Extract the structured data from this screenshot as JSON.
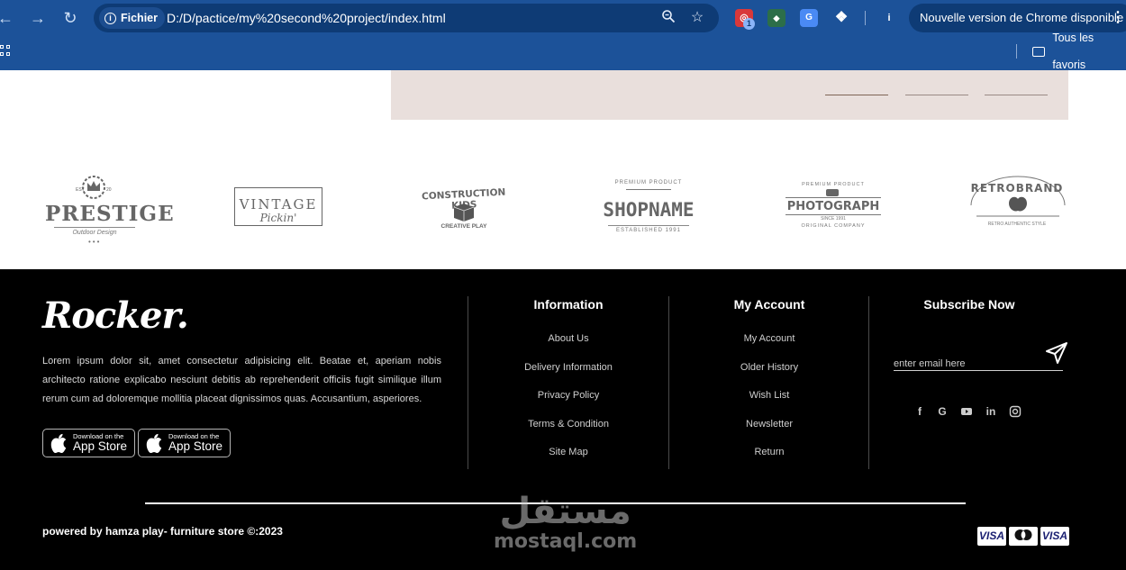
{
  "browser": {
    "back_icon": "arrow-left-icon",
    "forward_icon": "arrow-right-icon",
    "reload_icon": "reload-icon",
    "chip_label": "Fichier",
    "url": "D:/D/pactice/my%20second%20project/index.html",
    "zoom_icon": "zoom-icon",
    "star_icon": "star-icon",
    "ext_badge": "1",
    "update_text": "Nouvelle version de Chrome disponible",
    "menu_icon": "more-vert-icon",
    "bookmarks_label": "Tous les favoris"
  },
  "brands": [
    "PRESTIGE",
    "VINTAGE",
    "CONSTRUCTION KIDS",
    "SHOPNAME",
    "PHOTOGRAPH",
    "RETROBRAND"
  ],
  "brand_subtexts": {
    "prestige": "Outdoor Design",
    "vintage": "Pickin'",
    "construction": "CREATIVE PLAY",
    "shopname_top": "PREMIUM PRODUCT",
    "shopname_bottom": "ESTABLISHED 1991",
    "photograph_top": "PREMIUM PRODUCT",
    "photograph_mid": "SINCE 1991",
    "photograph_bottom": "ORIGINAL COMPANY",
    "retro_bottom": "RETRO AUTHENTIC STYLE"
  },
  "footer": {
    "logo": "Rocker.",
    "about": "Lorem ipsum dolor sit, amet consectetur adipisicing elit. Beatae et, aperiam nobis architecto ratione explicabo nesciunt debitis ab reprehenderit officiis fugit similique illum rerum cum ad doloremque mollitia placeat dignissimos quas. Accusantium, asperiores.",
    "store_small": "Download on the",
    "store_big": "App Store",
    "information": {
      "title": "Information",
      "links": [
        "About Us",
        "Delivery Information",
        "Privacy Policy",
        "Terms & Condition",
        "Site Map"
      ]
    },
    "account": {
      "title": "My Account",
      "links": [
        "My Account",
        "Older History",
        "Wish List",
        "Newsletter",
        "Return"
      ]
    },
    "subscribe": {
      "title": "Subscribe Now",
      "placeholder": "enter email here"
    },
    "social_icons": [
      "facebook-icon",
      "google-icon",
      "youtube-icon",
      "linkedin-icon",
      "instagram-icon"
    ],
    "copyright": "powered by hamza play- furniture store ©:2023",
    "payment": [
      "VISA",
      "MASTERCARD",
      "VISA"
    ]
  },
  "watermark": {
    "arabic": "مستقل",
    "latin": "mostaql.com"
  }
}
